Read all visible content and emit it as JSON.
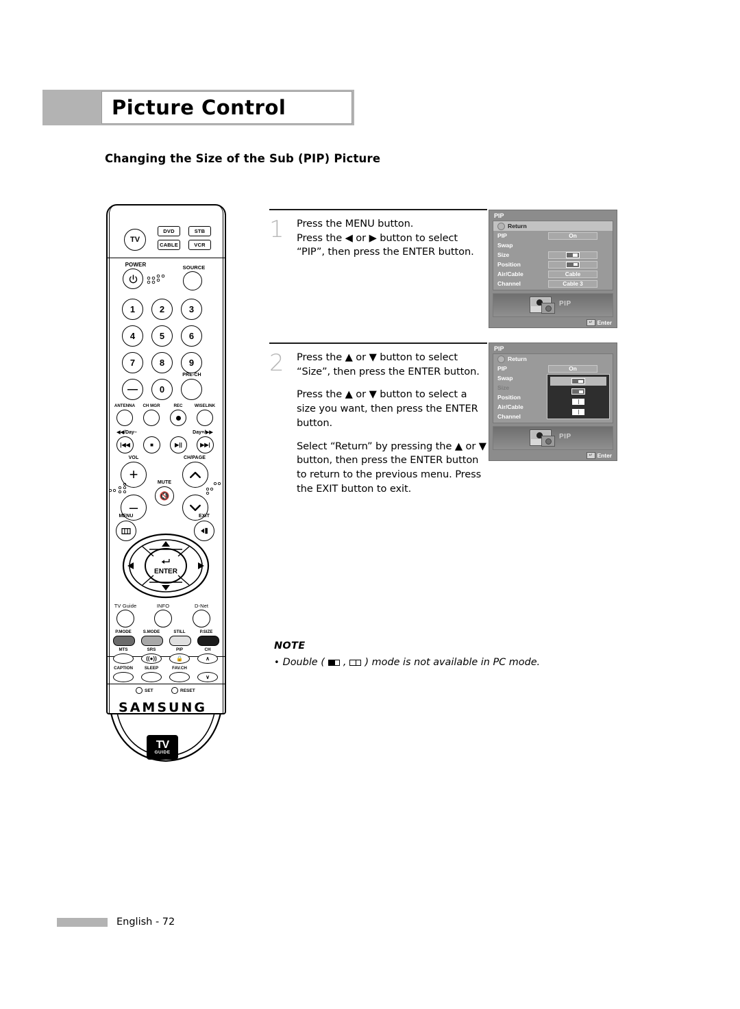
{
  "header": {
    "title": "Picture Control",
    "subtitle": "Changing the Size of the Sub (PIP) Picture"
  },
  "steps": [
    {
      "number": "1",
      "paragraphs": [
        "Press the MENU button.\nPress the ◀ or ▶ button to select “PIP”, then press the ENTER button."
      ]
    },
    {
      "number": "2",
      "paragraphs": [
        "Press the ▲ or ▼ button to select “Size”, then press the ENTER button.",
        "Press the ▲ or ▼ button to select a size you want, then press the ENTER button.",
        "Select “Return” by pressing the ▲ or ▼ button, then press the ENTER button to return to the previous menu. Press the EXIT button to exit."
      ]
    }
  ],
  "osd1": {
    "title": "PIP",
    "return_label": "Return",
    "rows": [
      {
        "label": "PIP",
        "value": "On",
        "type": "text"
      },
      {
        "label": "Swap",
        "value": "",
        "type": "none"
      },
      {
        "label": "Size",
        "value": "",
        "type": "glyph-pip-large"
      },
      {
        "label": "Position",
        "value": "",
        "type": "glyph-pip-small"
      },
      {
        "label": "Air/Cable",
        "value": "Cable",
        "type": "text"
      },
      {
        "label": "Channel",
        "value": "Cable 3",
        "type": "text"
      }
    ],
    "preview_label": "PIP",
    "enter_label": "Enter"
  },
  "osd2": {
    "title": "PIP",
    "return_label": "Return",
    "rows": [
      {
        "label": "PIP",
        "value": "On",
        "type": "text",
        "dim": false
      },
      {
        "label": "Swap",
        "value": "",
        "type": "none",
        "dim": false
      },
      {
        "label": "Size",
        "value": "",
        "type": "none",
        "dim": true
      },
      {
        "label": "Position",
        "value": "",
        "type": "none",
        "dim": false
      },
      {
        "label": "Air/Cable",
        "value": "",
        "type": "none",
        "dim": false
      },
      {
        "label": "Channel",
        "value": "",
        "type": "none",
        "dim": false
      }
    ],
    "size_options": [
      {
        "glyph": "pip-large",
        "selected": true
      },
      {
        "glyph": "pip-small",
        "selected": false
      },
      {
        "glyph": "double",
        "selected": false
      },
      {
        "glyph": "double",
        "selected": false
      }
    ],
    "preview_label": "PIP",
    "enter_label": "Enter"
  },
  "note": {
    "heading": "NOTE",
    "bullet": "•",
    "text_before": "Double (",
    "text_mid": ", ",
    "text_after": ") mode is not available in PC mode."
  },
  "footer": {
    "page_label": "English - 72"
  },
  "remote": {
    "brand": "SAMSUNG",
    "tvguide_line1": "TV",
    "tvguide_line2": "GUIDE",
    "device_buttons": [
      {
        "label": "TV"
      },
      {
        "label": "DVD"
      },
      {
        "label": "STB"
      },
      {
        "label": "CABLE"
      },
      {
        "label": "VCR"
      }
    ],
    "power_label": "POWER",
    "source_label": "SOURCE",
    "numbers": [
      "1",
      "2",
      "3",
      "4",
      "5",
      "6",
      "7",
      "8",
      "9",
      "—",
      "0",
      ""
    ],
    "prech_label": "PRE-CH",
    "row_labels_1": [
      "ANTENNA",
      "CH MGR",
      "REC",
      "WISELINK"
    ],
    "transport_left_label": "◀◀/Day–",
    "transport_right_label": "Day+/▶▶",
    "vol_label": "VOL",
    "chpage_label": "CH/PAGE",
    "mute_label": "MUTE",
    "menu_label": "MENU",
    "exit_label": "EXIT",
    "enter_label": "ENTER",
    "row_labels_2": [
      "TV Guide",
      "INFO",
      "D-Net"
    ],
    "row_labels_3": [
      "P.MODE",
      "S.MODE",
      "STILL",
      "P.SIZE"
    ],
    "row_labels_4": [
      "MTS",
      "SRS",
      "PIP",
      "CH"
    ],
    "row_labels_5": [
      "CAPTION",
      "SLEEP",
      "FAV.CH"
    ],
    "set_label": "SET",
    "reset_label": "RESET"
  },
  "colors": {
    "header_band": "#b3b3b3",
    "step_number": "#b8b8b8",
    "osd_bg": "#8c8c8c",
    "osd_panel": "#9a9a9a",
    "osd_highlight": "#c2c2c2",
    "dropdown_bg": "#2e2e2e"
  }
}
